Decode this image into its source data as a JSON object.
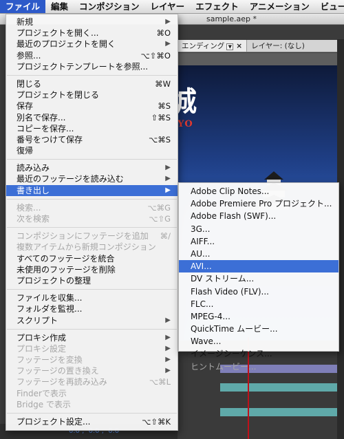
{
  "menubar": {
    "items": [
      "ファイル",
      "編集",
      "コンポジション",
      "レイヤー",
      "エフェクト",
      "アニメーション",
      "ビュー"
    ]
  },
  "window": {
    "title": "sample.aep *",
    "tabs": [
      "エンディング",
      "レイヤー: (なし)"
    ],
    "comp_title": "松本城",
    "comp_subtitle": "TOJYO",
    "bottom_values": [
      "0.0",
      "0.0",
      "0.0"
    ]
  },
  "file_menu": {
    "groups": [
      [
        {
          "label": "新規",
          "submenu": true
        },
        {
          "label": "プロジェクトを開く...",
          "shortcut": "⌘O"
        },
        {
          "label": "最近のプロジェクトを開く",
          "submenu": true
        },
        {
          "label": "参照...",
          "shortcut": "⌥⇧⌘O"
        },
        {
          "label": "プロジェクトテンプレートを参照..."
        }
      ],
      [
        {
          "label": "閉じる",
          "shortcut": "⌘W"
        },
        {
          "label": "プロジェクトを閉じる"
        },
        {
          "label": "保存",
          "shortcut": "⌘S"
        },
        {
          "label": "別名で保存...",
          "shortcut": "⇧⌘S"
        },
        {
          "label": "コピーを保存..."
        },
        {
          "label": "番号をつけて保存",
          "shortcut": "⌥⌘S"
        },
        {
          "label": "復帰"
        }
      ],
      [
        {
          "label": "読み込み",
          "submenu": true
        },
        {
          "label": "最近のフッテージを読み込む",
          "submenu": true
        },
        {
          "label": "書き出し",
          "submenu": true,
          "highlight": true
        }
      ],
      [
        {
          "label": "検索...",
          "shortcut": "⌥⌘G",
          "disabled": true
        },
        {
          "label": "次を検索",
          "shortcut": "⌥⇧G",
          "disabled": true
        }
      ],
      [
        {
          "label": "コンポジションにフッテージを追加",
          "shortcut": "⌘/",
          "disabled": true
        },
        {
          "label": "複数アイテムから新規コンポジション",
          "disabled": true
        },
        {
          "label": "すべてのフッテージを統合"
        },
        {
          "label": "未使用のフッテージを削除"
        },
        {
          "label": "プロジェクトの整理"
        }
      ],
      [
        {
          "label": "ファイルを収集..."
        },
        {
          "label": "フォルダを監視..."
        },
        {
          "label": "スクリプト",
          "submenu": true
        }
      ],
      [
        {
          "label": "プロキシ作成",
          "submenu": true
        },
        {
          "label": "プロキシ設定",
          "submenu": true,
          "disabled": true
        },
        {
          "label": "フッテージを変換",
          "submenu": true,
          "disabled": true
        },
        {
          "label": "フッテージの置き換え",
          "submenu": true,
          "disabled": true
        },
        {
          "label": "フッテージを再読み込み",
          "shortcut": "⌥⌘L",
          "disabled": true
        },
        {
          "label": "Finderで表示",
          "disabled": true
        },
        {
          "label": "Bridge で表示",
          "disabled": true
        }
      ],
      [
        {
          "label": "プロジェクト設定...",
          "shortcut": "⌥⇧⌘K"
        }
      ]
    ]
  },
  "export_submenu": {
    "items": [
      {
        "label": "Adobe Clip Notes..."
      },
      {
        "label": "Adobe Premiere Pro プロジェクト..."
      },
      {
        "label": "Adobe Flash (SWF)..."
      },
      {
        "label": "3G..."
      },
      {
        "label": "AIFF..."
      },
      {
        "label": "AU..."
      },
      {
        "label": "AVI...",
        "highlight": true
      },
      {
        "label": "DV ストリーム..."
      },
      {
        "label": "Flash Video (FLV)..."
      },
      {
        "label": "FLC..."
      },
      {
        "label": "MPEG-4..."
      },
      {
        "label": "QuickTime ムービー..."
      },
      {
        "label": "Wave..."
      },
      {
        "label": "イメージシーケンス..."
      },
      {
        "label": "ヒントムービー...",
        "disabled": true
      }
    ]
  },
  "colors": {
    "menu_highlight": "#3c6fd6",
    "menubar_active": "#2d5ac9",
    "disabled_text": "#a7a7a7",
    "playhead": "#c0101a"
  }
}
